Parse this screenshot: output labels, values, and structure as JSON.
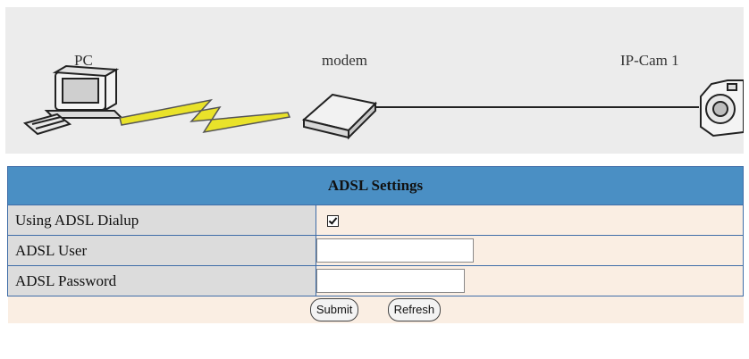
{
  "diagram": {
    "pc_label": "PC",
    "modem_label": "modem",
    "camera_label": "IP-Cam 1"
  },
  "settings": {
    "title": "ADSL Settings",
    "rows": [
      {
        "label": "Using ADSL Dialup",
        "type": "checkbox",
        "checked": true
      },
      {
        "label": "ADSL User",
        "type": "text",
        "value": ""
      },
      {
        "label": "ADSL Password",
        "type": "password",
        "value": ""
      }
    ],
    "submit_label": "Submit",
    "refresh_label": "Refresh"
  },
  "colors": {
    "header_bg": "#4a8fc4",
    "label_bg": "#dcdcdc",
    "value_bg": "#faeee3",
    "border": "#3f6da8"
  }
}
